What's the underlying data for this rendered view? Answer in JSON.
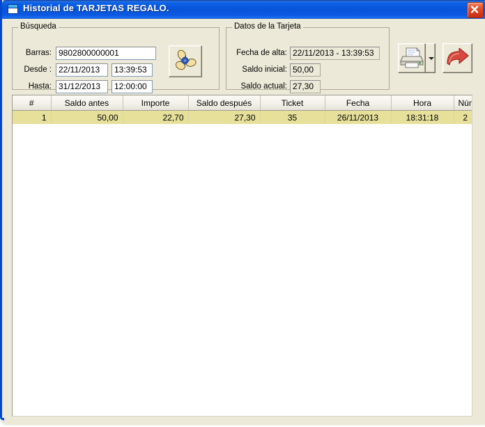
{
  "window": {
    "title": "Historial de TARJETAS REGALO.",
    "icon": "window-icon",
    "close_label": "×",
    "accent_titlebar": "#0b5fe0",
    "close_color": "#e24a25"
  },
  "busqueda": {
    "legend": "Búsqueda",
    "barras_label": "Barras:",
    "barras_value": "9802800000001",
    "desde_label": "Desde :",
    "desde_date": "22/11/2013",
    "desde_time": "13:39:53",
    "hasta_label": "Hasta:",
    "hasta_date": "31/12/2013",
    "hasta_time": "12:00:00",
    "search_button": "search-propeller-button"
  },
  "datos_tarjeta": {
    "legend": "Datos de la Tarjeta",
    "fecha_alta_label": "Fecha de alta:",
    "fecha_alta_value": "22/11/2013 - 13:39:53",
    "saldo_inicial_label": "Saldo inicial:",
    "saldo_inicial_value": "50,00",
    "saldo_actual_label": "Saldo actual:",
    "saldo_actual_value": "27,30"
  },
  "toolbar": {
    "print_button": "print-button",
    "print_dropdown": "print-dropdown",
    "exit_button": "exit-button"
  },
  "grid": {
    "columns": [
      "#",
      "Saldo antes",
      "Importe",
      "Saldo después",
      "Ticket",
      "Fecha",
      "Hora",
      "Núm. Reg."
    ],
    "rows": [
      {
        "num": "1",
        "saldo_antes": "50,00",
        "importe": "22,70",
        "saldo_despues": "27,30",
        "ticket": "35",
        "fecha": "26/11/2013",
        "hora": "18:31:18",
        "num_reg": "2"
      }
    ],
    "selected_row_color": "#e6e09b"
  }
}
